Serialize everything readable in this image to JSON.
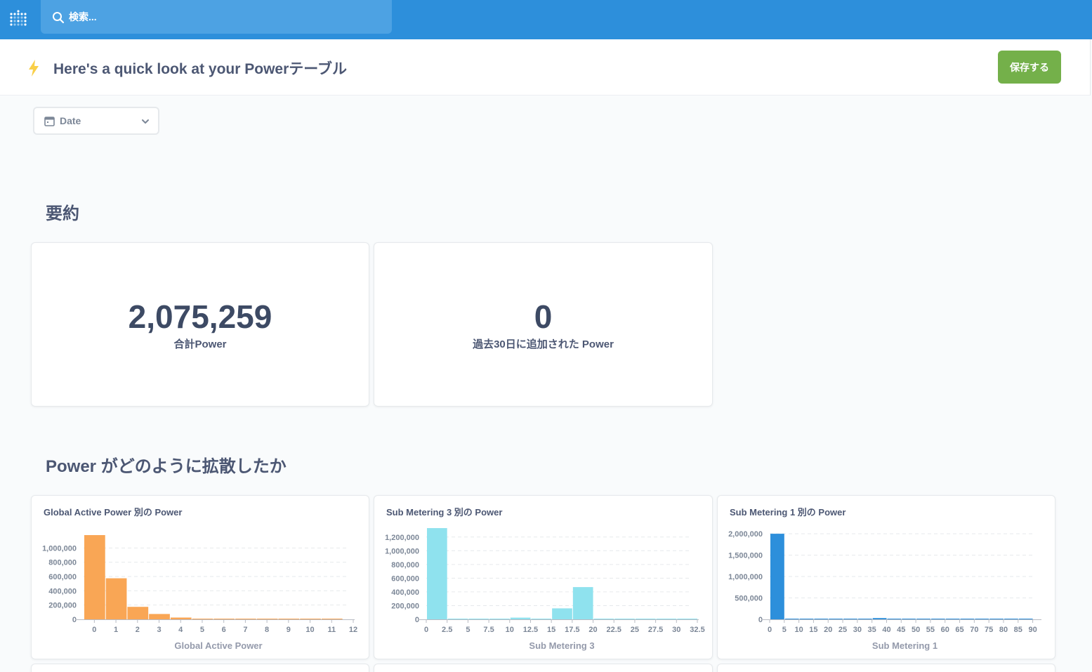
{
  "nav": {
    "logo_icon": "metabase-logo-icon",
    "search_icon": "search-icon",
    "search_placeholder": "検索..."
  },
  "header": {
    "bolt_icon": "lightning-bolt-icon",
    "title": "Here's a quick look at your Powerテーブル",
    "save_label": "保存する",
    "save_color": "#74b04a"
  },
  "filter": {
    "icon": "calendar-icon",
    "label": "Date",
    "chevron_icon": "chevron-down-icon"
  },
  "summary": {
    "title": "要約",
    "cards": [
      {
        "value": "2,075,259",
        "label": "合計Power"
      },
      {
        "value": "0",
        "label": "過去30日に追加された Power"
      }
    ]
  },
  "distribution": {
    "title": "Power がどのように拡散したか"
  },
  "chart_data": [
    {
      "type": "bar",
      "title": "Global Active Power 別の Power",
      "xlabel": "Global Active Power",
      "ylabel": "",
      "color": "#f9a655",
      "bin_width": 1,
      "xlim": [
        0,
        12.5
      ],
      "xticks": [
        "0",
        "1",
        "2",
        "3",
        "4",
        "5",
        "6",
        "7",
        "8",
        "9",
        "10",
        "11",
        "12"
      ],
      "ylim": [
        0,
        1200000
      ],
      "yticks": [
        "0",
        "200,000",
        "400,000",
        "600,000",
        "800,000",
        "1,000,000"
      ],
      "x": [
        0,
        1,
        2,
        3,
        4,
        5,
        6,
        7,
        8,
        9,
        10,
        11
      ],
      "values": [
        1180000,
        575000,
        175000,
        75000,
        25000,
        8000,
        4000,
        2000,
        1000,
        500,
        300,
        200
      ]
    },
    {
      "type": "bar",
      "title": "Sub Metering 3 別の Power",
      "xlabel": "Sub Metering 3",
      "ylabel": "",
      "color": "#8fe2ee",
      "bin_width": 2.5,
      "xlim": [
        0,
        32.5
      ],
      "xticks": [
        "0",
        "2.5",
        "5",
        "7.5",
        "10",
        "12.5",
        "15",
        "17.5",
        "20",
        "22.5",
        "25",
        "27.5",
        "30",
        "32.5"
      ],
      "ylim": [
        0,
        1300000
      ],
      "yticks": [
        "0",
        "200,000",
        "400,000",
        "600,000",
        "800,000",
        "1,000,000",
        "1,200,000"
      ],
      "x": [
        0,
        2.5,
        5,
        7.5,
        10,
        12.5,
        15,
        17.5,
        20,
        22.5,
        25,
        27.5,
        30
      ],
      "values": [
        1330000,
        3000,
        2000,
        4000,
        25000,
        5000,
        160000,
        470000,
        6000,
        3000,
        2000,
        1000,
        500
      ]
    },
    {
      "type": "bar",
      "title": "Sub Metering 1 別の Power",
      "xlabel": "Sub Metering 1",
      "ylabel": "",
      "color": "#2d8fdb",
      "bin_width": 5,
      "xlim": [
        0,
        92.5
      ],
      "xticks": [
        "0",
        "5",
        "10",
        "15",
        "20",
        "25",
        "30",
        "35",
        "40",
        "45",
        "50",
        "55",
        "60",
        "65",
        "70",
        "75",
        "80",
        "85",
        "90"
      ],
      "ylim": [
        0,
        2100000
      ],
      "yticks": [
        "0",
        "500,000",
        "1,000,000",
        "1,500,000",
        "2,000,000"
      ],
      "x": [
        0,
        5,
        10,
        15,
        20,
        25,
        30,
        35,
        40,
        45,
        50,
        55,
        60,
        65,
        70,
        75,
        80,
        85
      ],
      "values": [
        2000000,
        8000,
        6000,
        5000,
        5000,
        5000,
        8000,
        30000,
        10000,
        5000,
        3000,
        2000,
        2000,
        1000,
        1000,
        1000,
        500,
        500
      ]
    }
  ]
}
